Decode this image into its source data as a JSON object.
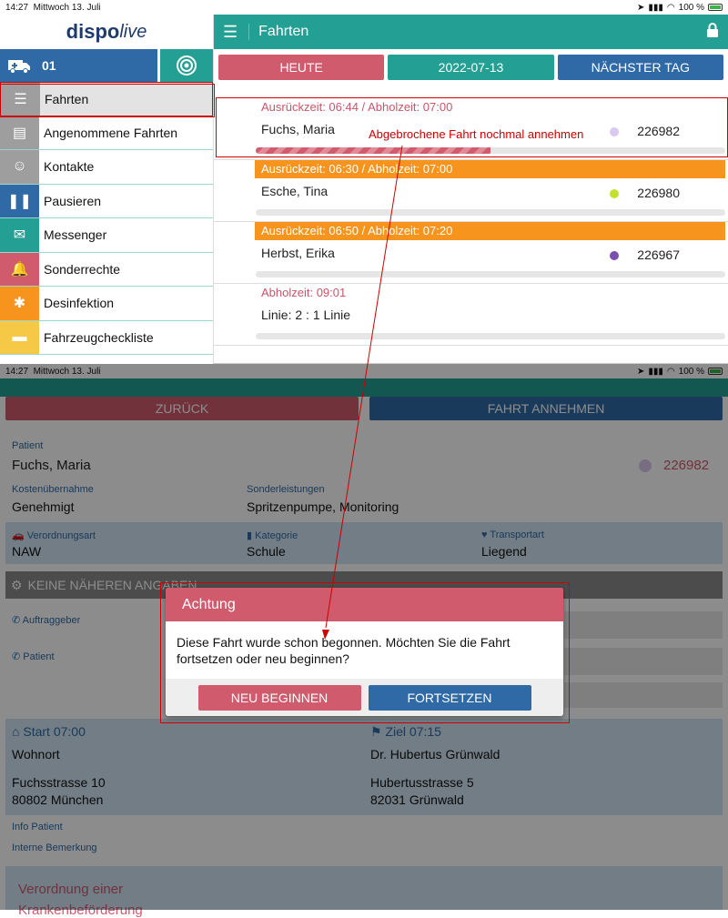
{
  "status": {
    "time": "14:27",
    "date": "Mittwoch 13. Juli",
    "battery": "100 %"
  },
  "brand": {
    "logo_main": "dispo",
    "logo_sub": "live"
  },
  "vehicle": {
    "id": "01"
  },
  "sidebar": {
    "items": [
      {
        "label": "Fahrten",
        "color": "#9e9e9e"
      },
      {
        "label": "Angenommene Fahrten",
        "color": "#9e9e9e"
      },
      {
        "label": "Kontakte",
        "color": "#9e9e9e"
      },
      {
        "label": "Pausieren",
        "color": "#2f6aa6"
      },
      {
        "label": "Messenger",
        "color": "#23a093"
      },
      {
        "label": "Sonderrechte",
        "color": "#cf5b6d"
      },
      {
        "label": "Desinfektion",
        "color": "#f7941d"
      },
      {
        "label": "Fahrzeugcheckliste",
        "color": "#f5c845"
      }
    ]
  },
  "header": {
    "title": "Fahrten"
  },
  "days": {
    "today": "HEUTE",
    "date": "2022-07-13",
    "next": "NÄCHSTER TAG"
  },
  "trips": [
    {
      "times": "Ausrückzeit: 06:44 / Abholzeit: 07:00",
      "name": "Fuchs, Maria",
      "number": "226982",
      "dot": "#d9c8ef",
      "progress": 0.5
    },
    {
      "times": "Ausrückzeit: 06:30 / Abholzeit: 07:00",
      "name": "Esche, Tina",
      "number": "226980",
      "dot": "#c3e12a",
      "progress": 0
    },
    {
      "times": "Ausrückzeit: 06:50 / Abholzeit: 07:20",
      "name": "Herbst, Erika",
      "number": "226967",
      "dot": "#7a4fb0",
      "progress": 0
    },
    {
      "times": "Abholzeit: 09:01",
      "name": "Linie: 2 : 1 Linie",
      "number": "",
      "progress": 0
    }
  ],
  "annotation": "Abgebrochene Fahrt nochmal annehmen",
  "detail": {
    "back": "ZURÜCK",
    "accept": "FAHRT ANNEHMEN",
    "patient_label": "Patient",
    "patient_name": "Fuchs, Maria",
    "patient_number": "226982",
    "cost_label": "Kostenübernahme",
    "cost_value": "Genehmigt",
    "special_label": "Sonderleistungen",
    "special_value": "Spritzenpumpe, Monitoring",
    "order_label": "Verordnungsart",
    "order_value": "NAW",
    "category_label": "Kategorie",
    "category_value": "Schule",
    "transport_label": "Transportart",
    "transport_value": "Liegend",
    "no_info": "KEINE NÄHEREN ANGABEN",
    "client_label": "Auftraggeber",
    "patient2_label": "Patient",
    "start_label": "Start 07:00",
    "start_name": "Wohnort",
    "start_street": "Fuchsstrasse 10",
    "start_city": "80802 München",
    "dest_label": "Ziel 07:15",
    "dest_name": "Dr. Hubertus Grünwald",
    "dest_street": "Hubertusstrasse 5",
    "dest_city": "82031 Grünwald",
    "info_patient": "Info Patient",
    "internal_note": "Interne Bemerkung",
    "verordnung": "Verordnung einer",
    "verordnung2": "Krankenbeförderung"
  },
  "dialog": {
    "title": "Achtung",
    "message": "Diese Fahrt wurde schon begonnen. Möchten Sie die Fahrt fortsetzen oder neu beginnen?",
    "restart": "NEU BEGINNEN",
    "continue": "FORTSETZEN"
  }
}
